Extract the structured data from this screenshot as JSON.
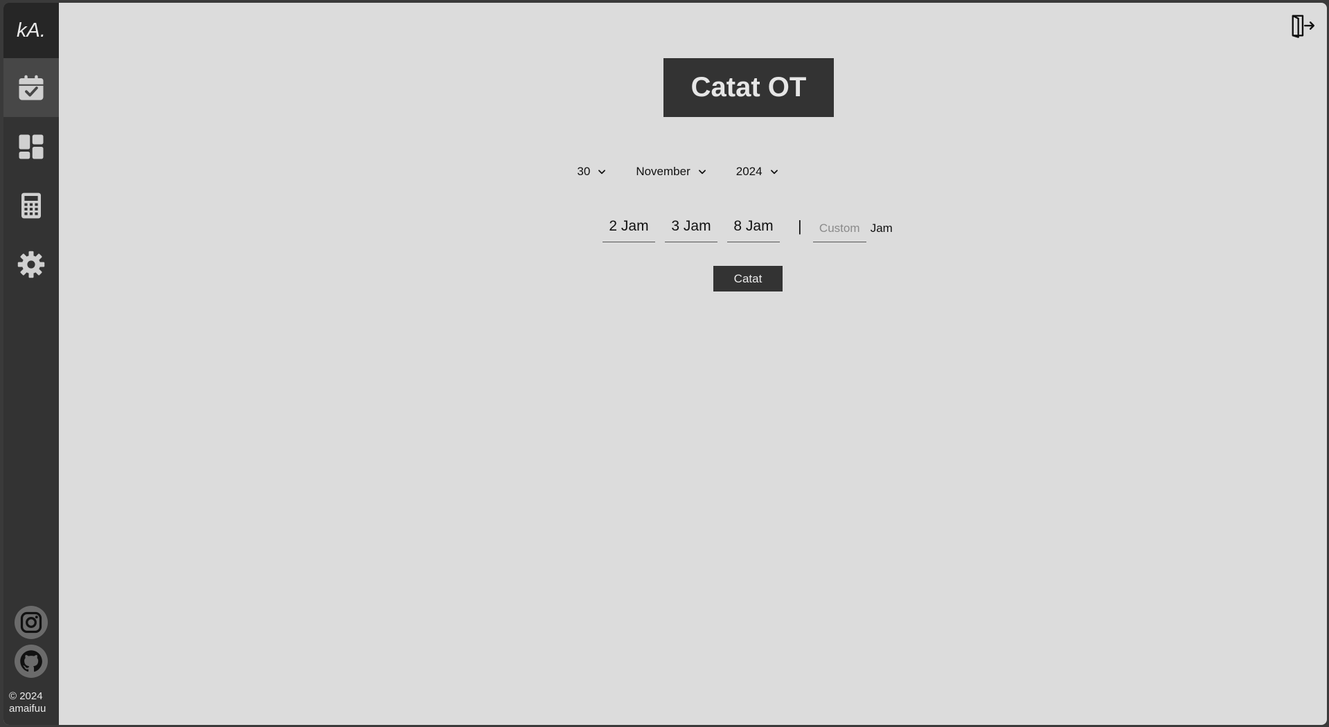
{
  "sidebar": {
    "logo": "kA.",
    "nav": [
      {
        "icon": "calendar-check-icon",
        "active": true
      },
      {
        "icon": "dashboard-icon",
        "active": false
      },
      {
        "icon": "calculator-icon",
        "active": false
      },
      {
        "icon": "gear-icon",
        "active": false
      }
    ],
    "social": [
      {
        "icon": "instagram-icon"
      },
      {
        "icon": "github-icon"
      }
    ],
    "copyright_line1": "© 2024",
    "copyright_line2": "amaifuu"
  },
  "header": {
    "logout_icon": "logout-icon"
  },
  "main": {
    "title": "Catat OT",
    "date": {
      "day": "30",
      "month": "November",
      "year": "2024"
    },
    "hour_options": [
      "2 Jam",
      "3 Jam",
      "8 Jam"
    ],
    "separator": "|",
    "custom_placeholder": "Custom",
    "custom_unit": "Jam",
    "submit_label": "Catat"
  },
  "colors": {
    "sidebar": "#333333",
    "sidebar_active": "#474747",
    "background": "#dcdcdc",
    "accent_dark": "#333333"
  }
}
